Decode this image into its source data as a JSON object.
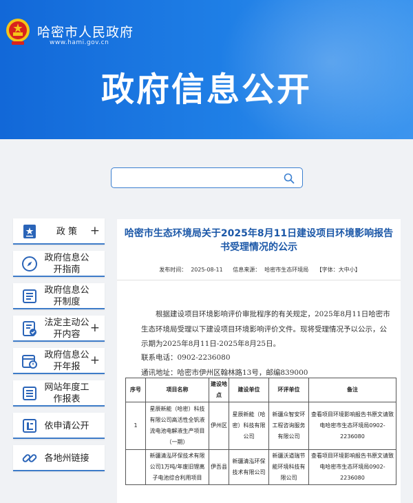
{
  "header": {
    "site_name": "哈密市人民政府",
    "site_url": "www.hami.gov.cn",
    "banner_title": "政府信息公开"
  },
  "search": {
    "placeholder": "",
    "icon": "search-icon"
  },
  "sidebar": {
    "items": [
      {
        "label": "政 策",
        "icon": "policy-doc-icon",
        "has_plus": true,
        "plus": "+"
      },
      {
        "label": "政府信息公开指南",
        "icon": "compass-icon",
        "has_plus": false,
        "plus": ""
      },
      {
        "label": "政府信息公开制度",
        "icon": "list-doc-icon",
        "has_plus": false,
        "plus": ""
      },
      {
        "label": "法定主动公开内容",
        "icon": "checklist-doc-icon",
        "has_plus": true,
        "plus": "+"
      },
      {
        "label": "政府信息公开年报",
        "icon": "calendar-report-icon",
        "has_plus": true,
        "plus": "+"
      },
      {
        "label": "网站年度工作报表",
        "icon": "report-list-icon",
        "has_plus": false,
        "plus": ""
      },
      {
        "label": "依申请公开",
        "icon": "application-icon",
        "has_plus": false,
        "plus": ""
      },
      {
        "label": "各地州链接",
        "icon": "link-chain-icon",
        "has_plus": false,
        "plus": ""
      }
    ]
  },
  "article": {
    "title": "哈密市生态环境局关于2025年8月11日建设项目环境影响报告书受理情况的公示",
    "publish_label": "发布时间：",
    "publish_date": "2025-08-11",
    "source_label": "信息来源：",
    "source": "哈密市生态环境局",
    "font_size_label": "【字体：大中小】",
    "body": "根据建设项目环境影响评价审批程序的有关规定，2025年8月11日哈密市生态环境局受理以下建设项目环境影响评价文件。现将受理情况予以公示，公示期为2025年8月11日-2025年8月25日。",
    "phone_line": "联系电话：0902-2236080",
    "address_line": "通讯地址：哈密市伊州区翰林路13号，邮编839000"
  },
  "table": {
    "headers": [
      "序号",
      "项目名称",
      "建设地点",
      "建设单位",
      "环评单位",
      "备注"
    ],
    "rows": [
      {
        "no": "1",
        "name": "星辰新能（哈密）科技有限公司高活性全钒液流电池电解液生产项目（一期）",
        "location": "伊州区",
        "builder": "星辰新能（哈密）科技有限公司",
        "eia": "新疆众智安环工程咨询服务有限公司",
        "note": "查看项目环境影响报告书原文请致电哈密市生态环境局0902-2236080"
      },
      {
        "no": "",
        "name": "新疆清泓环保技术有限公司1万吨/年废旧锂离子电池综合利用项目",
        "location": "伊吾县",
        "builder": "新疆清泓环保技术有限公司",
        "eia": "新疆沃道瑞节能环境科技有限公司",
        "note": "查看项目环境影响报告书原文请致电哈密市生态环境局0902-2236080"
      }
    ]
  },
  "colors": {
    "header_blue": "#1f7fe6",
    "title_blue": "#1c58a8",
    "nav_border": "#3d7bc8",
    "page_bg": "#f0f2f5"
  }
}
